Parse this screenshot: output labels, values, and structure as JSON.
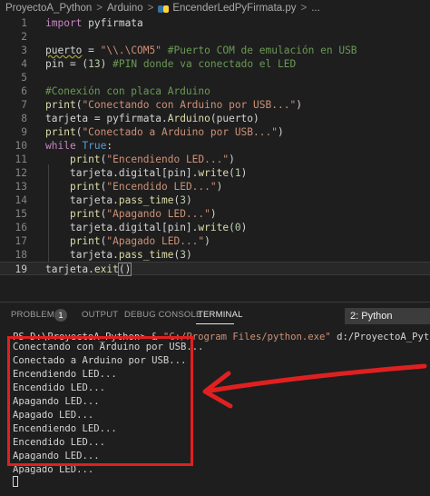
{
  "breadcrumb": {
    "items": [
      "ProyectoA_Python",
      "Arduino",
      "EncenderLedPyFirmata.py",
      "..."
    ],
    "separator": ">"
  },
  "editor": {
    "lines": [
      {
        "n": "1"
      },
      {
        "n": "2"
      },
      {
        "n": "3"
      },
      {
        "n": "4"
      },
      {
        "n": "5"
      },
      {
        "n": "6"
      },
      {
        "n": "7"
      },
      {
        "n": "8"
      },
      {
        "n": "9"
      },
      {
        "n": "10"
      },
      {
        "n": "11"
      },
      {
        "n": "12"
      },
      {
        "n": "13"
      },
      {
        "n": "14"
      },
      {
        "n": "15"
      },
      {
        "n": "16"
      },
      {
        "n": "17"
      },
      {
        "n": "18"
      },
      {
        "n": "19"
      }
    ],
    "tokens": {
      "l1_kw": "import",
      "l1_mod": " pyfirmata",
      "l3_var": "puerto",
      "l3_eq": " = ",
      "l3_str": "\"\\\\.\\COM5\"",
      "l3_cm": " #Puerto COM de emulación en USB",
      "l4_var": "pin",
      "l4_eq": " = (",
      "l4_num": "13",
      "l4_close": ") ",
      "l4_cm": "#PIN donde va conectado el LED",
      "l6_cm": "#Conexión con placa Arduino",
      "l7_fn": "print",
      "l7_open": "(",
      "l7_str": "\"Conectando con Arduino por USB...\"",
      "l7_close": ")",
      "l8_var": "tarjeta = pyfirmata.",
      "l8_fn": "Arduino",
      "l8_rest": "(puerto)",
      "l9_fn": "print",
      "l9_open": "(",
      "l9_str": "\"Conectado a Arduino por USB...\"",
      "l9_close": ")",
      "l10_kw": "while",
      "l10_sp": " ",
      "l10_bl": "True",
      "l10_colon": ":",
      "l11_fn": "print",
      "l11_open": "(",
      "l11_str": "\"Encendiendo LED...\"",
      "l11_close": ")",
      "l12_a": "tarjeta.digital[pin].",
      "l12_fn": "write",
      "l12_open": "(",
      "l12_num": "1",
      "l12_close": ")",
      "l13_fn": "print",
      "l13_open": "(",
      "l13_str": "\"Encendido LED...\"",
      "l13_close": ")",
      "l14_a": "tarjeta.",
      "l14_fn": "pass_time",
      "l14_open": "(",
      "l14_num": "3",
      "l14_close": ")",
      "l15_fn": "print",
      "l15_open": "(",
      "l15_str": "\"Apagando LED...\"",
      "l15_close": ")",
      "l16_a": "tarjeta.digital[pin].",
      "l16_fn": "write",
      "l16_open": "(",
      "l16_num": "0",
      "l16_close": ")",
      "l17_fn": "print",
      "l17_open": "(",
      "l17_str": "\"Apagado LED...\"",
      "l17_close": ")",
      "l18_a": "tarjeta.",
      "l18_fn": "pass_time",
      "l18_open": "(",
      "l18_num": "3",
      "l18_close": ")",
      "l19_a": "tarjeta.",
      "l19_fn": "exit",
      "l19_parens": "()"
    }
  },
  "panel": {
    "tabs": [
      "PROBLEMS",
      "OUTPUT",
      "DEBUG CONSOLE",
      "TERMINAL"
    ],
    "problems_count": "1",
    "active_tab": "TERMINAL",
    "terminal_selector": "2: Python"
  },
  "terminal": {
    "prompt": "PS D:\\ProyectoA_Python> & ",
    "exe": "\"C:/Program Files/python.exe\"",
    "script": " d:/ProyectoA_Python/Arduino",
    "output": [
      "Conectando con Arduino por USB...",
      "Conectado a Arduino por USB...",
      "Encendiendo LED...",
      "Encendido LED...",
      "Apagando LED...",
      "Apagado LED...",
      "Encendiendo LED...",
      "Encendido LED...",
      "Apagando LED...",
      "Apagado LED..."
    ]
  },
  "colors": {
    "background": "#1e1e1e",
    "keyword": "#c586c0",
    "builtin": "#569cd6",
    "function": "#dcdcaa",
    "string": "#ce9178",
    "comment": "#6a9955",
    "number": "#b5cea8",
    "annotation": "#e02020"
  }
}
